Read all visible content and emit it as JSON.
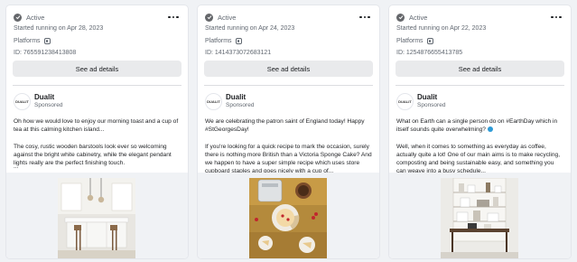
{
  "ads": [
    {
      "status": "Active",
      "started": "Started running on Apr 28, 2023",
      "platforms_label": "Platforms",
      "platform_icon": "instagram-icon",
      "ad_id": "ID: 765591238413808",
      "details_label": "See ad details",
      "advertiser": "Dualit",
      "avatar_text": "DUALIT",
      "sponsored": "Sponsored",
      "text_p1": "Oh how we would love to enjoy our morning toast and a cup of tea at this calming kitchen island...",
      "text_p2": "The cosy, rustic wooden barstools look ever so welcoming against the bright white cabinetry, while the elegant pendant lights really are the perfect finishing touch.",
      "ellipsis": "...",
      "image": "kitchen-island-photo"
    },
    {
      "status": "Active",
      "started": "Started running on Apr 24, 2023",
      "platforms_label": "Platforms",
      "platform_icon": "instagram-icon",
      "ad_id": "ID: 1414373072683121",
      "details_label": "See ad details",
      "advertiser": "Dualit",
      "avatar_text": "DUALIT",
      "sponsored": "Sponsored",
      "text_p1": "We are celebrating the patron saint of England today! Happy #StGeorgesDay!",
      "text_p2": "If you're looking for a quick recipe to mark the occasion, surely there is nothing more British than a Victoria Sponge Cake? And we happen to have a super simple recipe which uses store cupboard staples and goes nicely with a cup of...",
      "ellipsis": "",
      "image": "victoria-sponge-photo"
    },
    {
      "status": "Active",
      "started": "Started running on Apr 22, 2023",
      "platforms_label": "Platforms",
      "platform_icon": "instagram-icon",
      "ad_id": "ID: 1254876655413785",
      "details_label": "See ad details",
      "advertiser": "Dualit",
      "avatar_text": "DUALIT",
      "sponsored": "Sponsored",
      "text_p1": "What on Earth can a single person do on #EarthDay which in itself sounds quite overwhelming?",
      "text_p2": "Well, when it comes to something as everyday as coffee, actually quite a lot! One of our main aims is to make recycling, composting and being sustainable easy, and something you can weave into a busy schedule...",
      "ellipsis": "",
      "image": "kitchen-shelves-photo"
    }
  ],
  "colors": {
    "page_bg": "#f0f2f5",
    "card_bg": "#ffffff",
    "button_bg": "#e9eaec",
    "muted_text": "#606770",
    "earth_emoji": "#2e9bd6"
  }
}
